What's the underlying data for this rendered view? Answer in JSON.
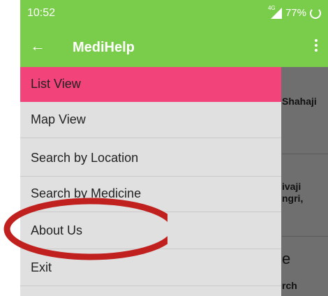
{
  "status_bar": {
    "time": "10:52",
    "network": "4G",
    "battery": "77%"
  },
  "app_bar": {
    "title": "MediHelp",
    "back_icon": "arrow-left-icon",
    "menu_icon": "more-vert-icon"
  },
  "drawer": {
    "items": [
      {
        "label": "List View",
        "selected": true
      },
      {
        "label": "Map View",
        "selected": false
      },
      {
        "label": "Search by Location",
        "selected": false
      },
      {
        "label": "Search by Medicine",
        "selected": false
      },
      {
        "label": "About Us",
        "selected": false
      },
      {
        "label": "Exit",
        "selected": false
      }
    ]
  },
  "background_list": {
    "card1_text": "Shahaji",
    "card2_line1": "ivaji",
    "card2_line2": "ngri,",
    "card3_big": "e",
    "card3_text": "rch"
  },
  "annotation": {
    "color": "#c0201e",
    "target": "About Us"
  },
  "colors": {
    "app_bar": "#79cd4a",
    "selected_item": "#f2437a",
    "drawer_bg": "#e0e0e0",
    "scrim": "#6f6f6f"
  }
}
